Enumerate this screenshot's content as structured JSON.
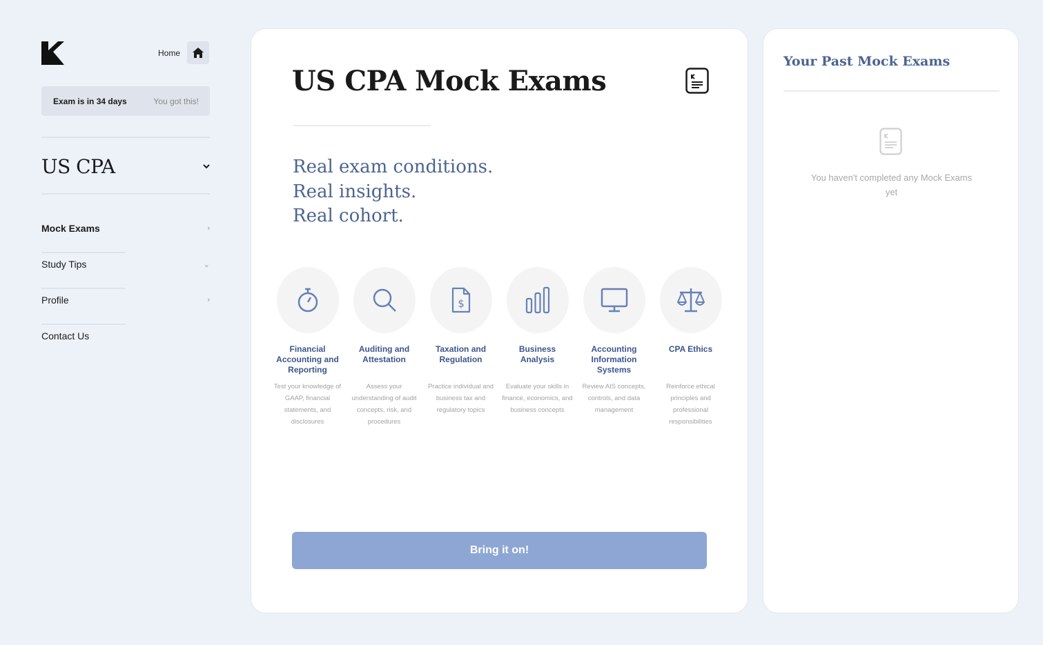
{
  "sidebar": {
    "home_label": "Home",
    "countdown": {
      "days_text": "Exam is in 34 days",
      "encouragement": "You got this!"
    },
    "course": "US CPA",
    "nav": [
      {
        "label": "Mock Exams",
        "chevron": "›"
      },
      {
        "label": "Study Tips",
        "chevron": "⌄"
      },
      {
        "label": "Profile",
        "chevron": "›"
      },
      {
        "label": "Contact Us",
        "chevron": ""
      }
    ]
  },
  "main": {
    "title": "US CPA Mock Exams",
    "tagline": [
      "Real exam conditions.",
      "Real insights.",
      "Real cohort."
    ],
    "categories": [
      {
        "icon": "stopwatch-icon",
        "name": "Financial Accounting and Reporting",
        "desc": "Test your knowledge of GAAP, financial statements, and disclosures"
      },
      {
        "icon": "search-icon",
        "name": "Auditing and Attestation",
        "desc": "Assess your understanding of audit concepts, risk, and procedures"
      },
      {
        "icon": "dollar-document-icon",
        "name": "Taxation and Regulation",
        "desc": "Practice individual and business tax and regulatory topics"
      },
      {
        "icon": "bar-chart-icon",
        "name": "Business Analysis",
        "desc": "Evaluate your skills in finance, economics, and business concepts"
      },
      {
        "icon": "monitor-icon",
        "name": "Accounting Information Systems",
        "desc": "Review AIS concepts, controls, and data management"
      },
      {
        "icon": "scales-icon",
        "name": "CPA Ethics",
        "desc": "Reinforce ethical principles and professional responsibilities"
      }
    ],
    "cta_label": "Bring it on!"
  },
  "past_exams": {
    "title": "Your Past Mock Exams",
    "empty_message": "You haven't completed any Mock Exams yet"
  },
  "colors": {
    "accent": "#4b6490",
    "icon": "#6680b8",
    "button": "#8ea6d3",
    "background": "#edf2f9"
  }
}
